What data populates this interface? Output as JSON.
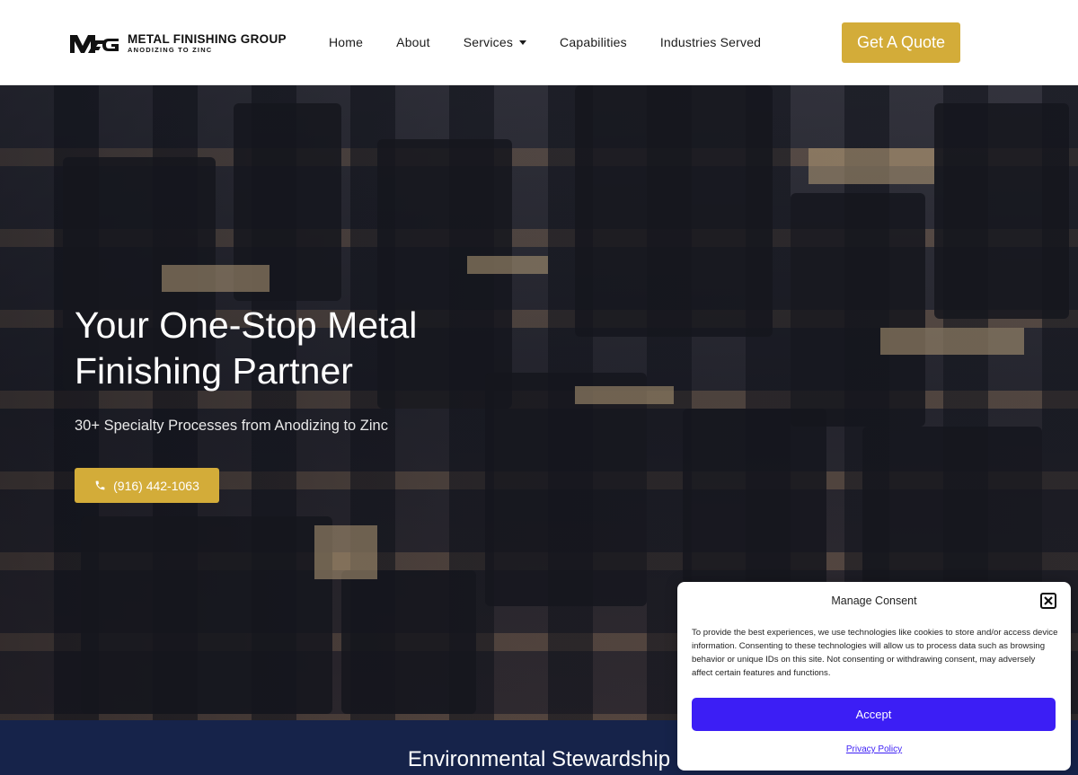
{
  "brand": {
    "title": "METAL FINISHING GROUP",
    "tagline": "ANODIZING TO ZINC",
    "logo_icon": "mfg-logo-icon"
  },
  "nav": {
    "items": [
      {
        "label": "Home"
      },
      {
        "label": "About"
      },
      {
        "label": "Services",
        "has_dropdown": true
      },
      {
        "label": "Capabilities"
      },
      {
        "label": "Industries Served"
      }
    ],
    "quote_button": "Get A Quote"
  },
  "hero": {
    "title": "Your One-Stop Metal Finishing Partner",
    "subtitle": "30+ Specialty Processes from Anodizing to Zinc",
    "phone": "(916) 442-1063",
    "phone_icon": "phone-icon"
  },
  "band": {
    "title": "Environmental Stewardship"
  },
  "consent": {
    "title": "Manage Consent",
    "body": "To provide the best experiences, we use technologies like cookies to store and/or access device information. Consenting to these technologies will allow us to process data such as browsing behavior or unique IDs on this site. Not consenting or withdrawing consent, may adversely affect certain features and functions.",
    "accept": "Accept",
    "privacy": "Privacy Policy",
    "close_icon": "close-icon"
  },
  "colors": {
    "accent": "#d3ac39",
    "band": "#16234a",
    "consent_button": "#3c1ef5"
  }
}
